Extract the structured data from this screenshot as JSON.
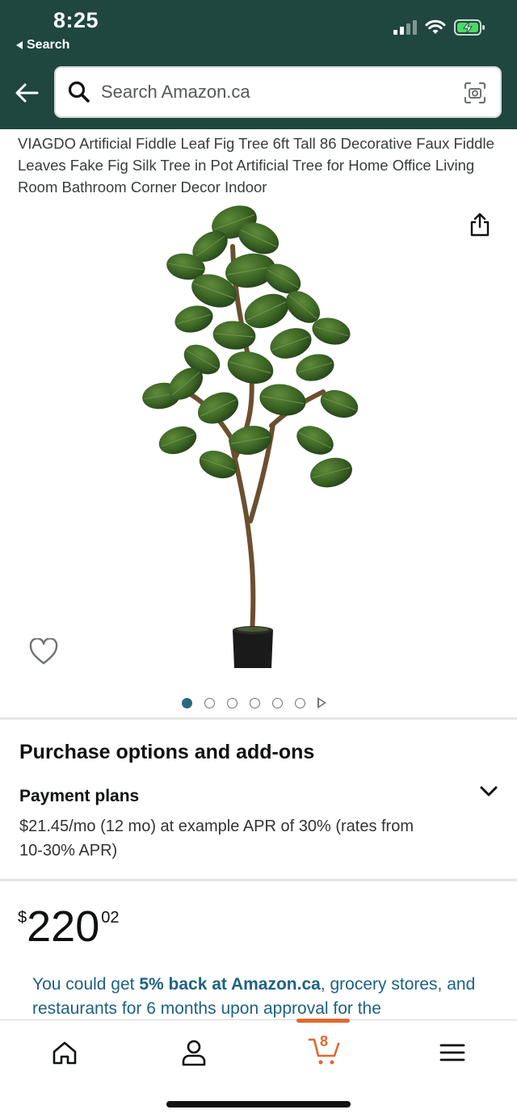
{
  "status_bar": {
    "time": "8:25",
    "back_label": "Search"
  },
  "search": {
    "placeholder": "Search Amazon.ca"
  },
  "product": {
    "title": "VIAGDO Artificial Fiddle Leaf Fig Tree 6ft Tall 86 Decorative Faux Fiddle Leaves Fake Fig Silk Tree in Pot Artificial Tree for Home Office Living Room Bathroom Corner Decor Indoor",
    "image_count": 6,
    "active_image": 1
  },
  "purchase": {
    "title": "Purchase options and add-ons",
    "plans_label": "Payment plans",
    "plans_detail": "$21.45/mo (12 mo) at example APR of 30% (rates from 10-30% APR)"
  },
  "price": {
    "symbol": "$",
    "whole": "220",
    "fraction": "02"
  },
  "promo": {
    "prefix": "You could get ",
    "highlight": "5% back at Amazon.ca",
    "suffix": ", grocery stores, and restaurants for 6 months upon approval for the"
  },
  "tabbar": {
    "cart_count": "8"
  },
  "colors": {
    "header_bg": "#1f463f",
    "link": "#1e6280",
    "cart_accent": "#e0682f",
    "active_dot": "#2a6a80"
  },
  "icons": [
    "back-arrow-icon",
    "search-icon",
    "camera-icon",
    "share-icon",
    "heart-icon",
    "chevron-down-icon",
    "home-icon",
    "profile-icon",
    "cart-icon",
    "menu-icon"
  ]
}
